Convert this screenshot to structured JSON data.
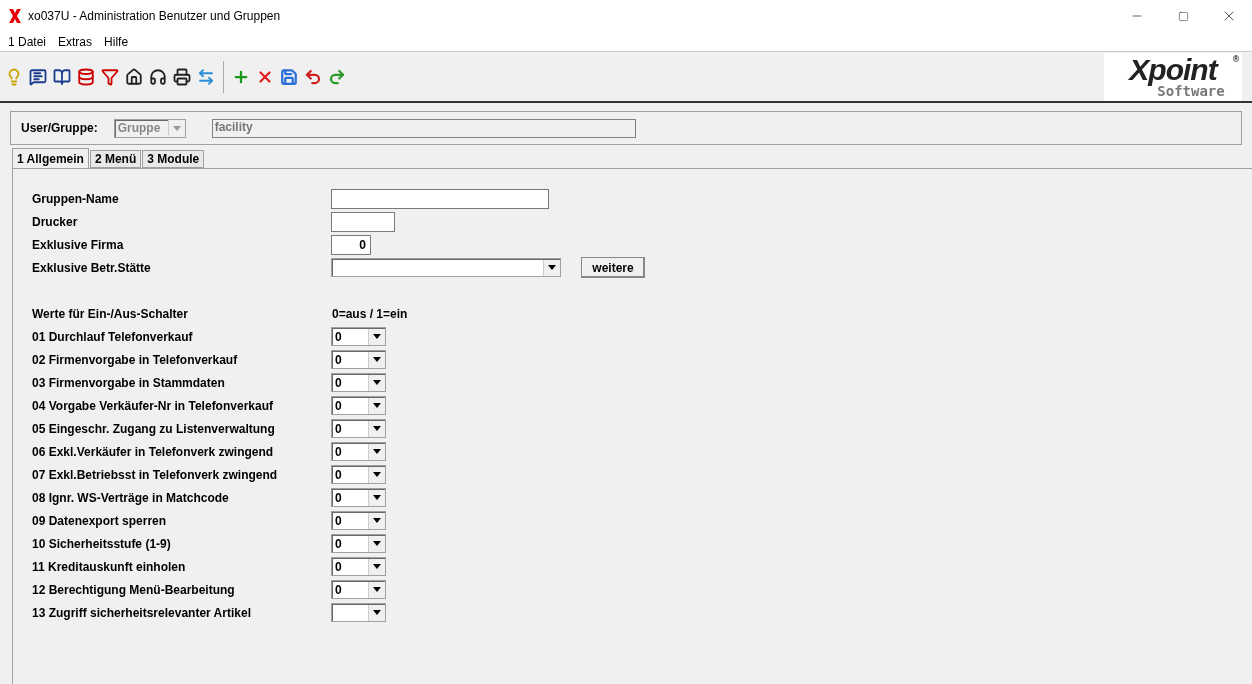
{
  "window": {
    "title": "xo037U - Administration Benutzer und Gruppen"
  },
  "menu": [
    "1 Datei",
    "Extras",
    "Hilfe"
  ],
  "logo": {
    "brand": "Xpoint",
    "sub": "Software",
    "mark": "®"
  },
  "header": {
    "label": "User/Gruppe:",
    "type_value": "Gruppe",
    "name_value": "facility"
  },
  "tabs": [
    {
      "label": "1 Allgemein",
      "selected": true
    },
    {
      "label": "2 Menü",
      "selected": false
    },
    {
      "label": "3 Module",
      "selected": false
    }
  ],
  "fields": [
    {
      "label": "Gruppen-Name",
      "kind": "text"
    },
    {
      "label": "Drucker",
      "kind": "short"
    },
    {
      "label": "Exklusive Firma",
      "kind": "number",
      "value": "0"
    },
    {
      "label": "Exklusive Betr.Stätte",
      "kind": "combo",
      "button": "weitere"
    }
  ],
  "switches_header": {
    "label": "Werte für Ein-/Aus-Schalter",
    "legend": "0=aus / 1=ein"
  },
  "switches": [
    {
      "label": "01 Durchlauf Telefonverkauf",
      "value": "0"
    },
    {
      "label": "02 Firmenvorgabe in Telefonverkauf",
      "value": "0"
    },
    {
      "label": "03 Firmenvorgabe in Stammdaten",
      "value": "0"
    },
    {
      "label": "04 Vorgabe Verkäufer-Nr in Telefonverkauf",
      "value": "0"
    },
    {
      "label": "05 Eingeschr. Zugang zu Listenverwaltung",
      "value": "0"
    },
    {
      "label": "06 Exkl.Verkäufer in Telefonverk zwingend",
      "value": "0"
    },
    {
      "label": "07 Exkl.Betriebsst in Telefonverk zwingend",
      "value": "0"
    },
    {
      "label": "08 Ignr. WS-Verträge in Matchcode",
      "value": "0"
    },
    {
      "label": "09 Datenexport sperren",
      "value": "0"
    },
    {
      "label": "10 Sicherheitsstufe (1-9)",
      "value": "0"
    },
    {
      "label": "11 Kreditauskunft einholen",
      "value": "0"
    },
    {
      "label": "12 Berechtigung Menü-Bearbeitung",
      "value": "0"
    },
    {
      "label": "13 Zugriff sicherheitsrelevanter Artikel"
    }
  ]
}
